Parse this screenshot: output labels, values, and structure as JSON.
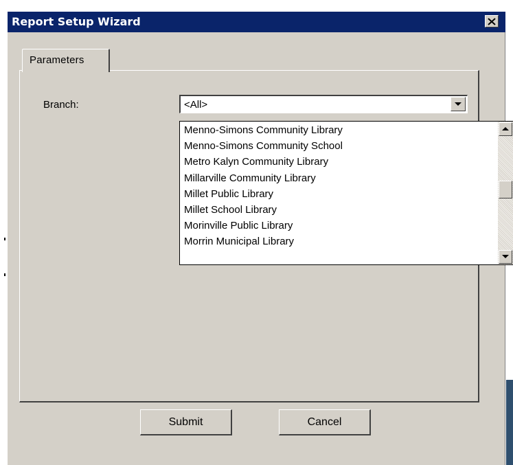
{
  "window": {
    "title": "Report Setup Wizard",
    "titlebar_color": "#0a246a",
    "face_color": "#d4d0c8"
  },
  "tabs": [
    {
      "label": "Parameters",
      "selected": true
    }
  ],
  "form": {
    "branch_label": "Branch:",
    "branch_value": "<All>",
    "dropdown_open": true,
    "options": [
      "Menno-Simons Community Library",
      "Menno-Simons Community School",
      "Metro Kalyn Community Library",
      "Millarville Community Library",
      "Millet Public Library",
      "Millet School Library",
      "Morinville Public Library",
      "Morrin Municipal Library"
    ]
  },
  "buttons": {
    "submit": "Submit",
    "cancel": "Cancel"
  },
  "icons": {
    "close": "close-icon",
    "combo_arrow": "chevron-down-icon",
    "scroll_up": "arrow-up-icon",
    "scroll_down": "arrow-down-icon"
  }
}
